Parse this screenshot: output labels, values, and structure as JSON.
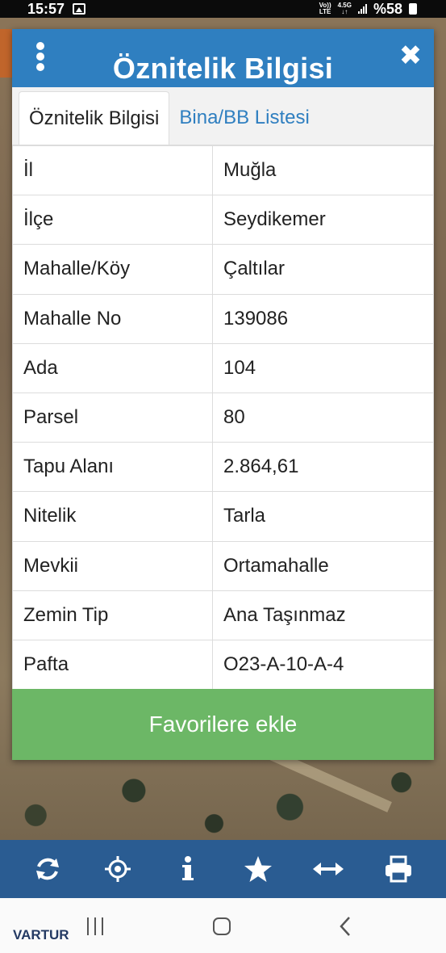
{
  "status_bar": {
    "time": "15:57",
    "network_top": "Vo))",
    "network_bottom": "LTE",
    "net_type": "4.5G",
    "battery": "%58"
  },
  "dialog": {
    "title": "Öznitelik Bilgisi",
    "tabs": [
      {
        "label": "Öznitelik Bilgisi",
        "active": true
      },
      {
        "label": "Bina/BB Listesi",
        "active": false
      }
    ],
    "rows": [
      {
        "key": "İl",
        "value": "Muğla"
      },
      {
        "key": "İlçe",
        "value": "Seydikemer"
      },
      {
        "key": "Mahalle/Köy",
        "value": "Çaltılar"
      },
      {
        "key": "Mahalle No",
        "value": "139086"
      },
      {
        "key": "Ada",
        "value": "104"
      },
      {
        "key": "Parsel",
        "value": "80"
      },
      {
        "key": "Tapu Alanı",
        "value": "2.864,61"
      },
      {
        "key": "Nitelik",
        "value": "Tarla"
      },
      {
        "key": "Mevkii",
        "value": "Ortamahalle"
      },
      {
        "key": "Zemin Tip",
        "value": "Ana Taşınmaz"
      },
      {
        "key": "Pafta",
        "value": "O23-A-10-A-4"
      }
    ],
    "favorite_button": "Favorilere ekle"
  },
  "toolbar": {
    "icons": [
      "refresh-icon",
      "locate-icon",
      "info-icon",
      "star-icon",
      "measure-icon",
      "print-icon"
    ]
  },
  "watermark": "VARTUR",
  "colors": {
    "header": "#2f7fc0",
    "button": "#6cb766",
    "toolbar": "#2a5c92"
  }
}
